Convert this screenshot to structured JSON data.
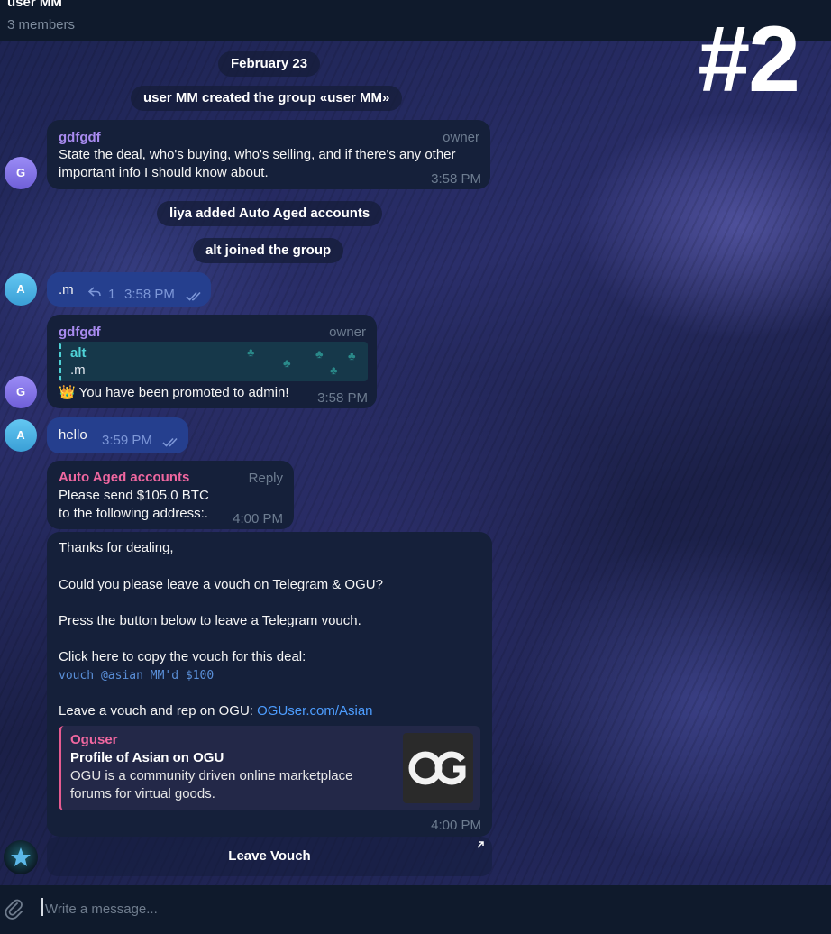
{
  "header": {
    "title": "user MM",
    "subtitle": "3 members"
  },
  "watermark": "#2",
  "service": {
    "date": "February 23",
    "created": "user MM created the group «user MM»",
    "added": "liya added Auto Aged accounts",
    "joined": "alt joined the group"
  },
  "messages": {
    "m1": {
      "avatar": "G",
      "sender": "gdfgdf",
      "role": "owner",
      "lines": [
        "State the deal, who's buying, who's selling, and if there's any other",
        "important info I should know about."
      ],
      "time": "3:58 PM"
    },
    "m2": {
      "avatar": "A",
      "text": ".m",
      "replies": "1",
      "time": "3:58 PM"
    },
    "m3": {
      "avatar": "G",
      "sender": "gdfgdf",
      "role": "owner",
      "reply_name": "alt",
      "reply_text": ".m",
      "emoji": "👑",
      "text": "You have been promoted to admin!",
      "time": "3:58 PM"
    },
    "m4": {
      "avatar": "A",
      "text": "hello",
      "time": "3:59 PM"
    },
    "m5": {
      "sender": "Auto Aged accounts",
      "role": "Reply",
      "lines": [
        "Please send $105.0 BTC",
        "to the following address:."
      ],
      "time": "4:00 PM"
    },
    "m6": {
      "p1": "Thanks for dealing,",
      "p2": "Could you please leave a vouch on Telegram & OGU?",
      "p3": "Press the button below to leave a Telegram vouch.",
      "p4": "Click here to copy the vouch for this deal:",
      "code": "vouch @asian MM'd $100",
      "p5_prefix": "Leave a vouch and rep on OGU: ",
      "p5_link": "OGUser.com/Asian",
      "preview": {
        "site": "Oguser",
        "title": "Profile of Asian on OGU",
        "desc": "OGU is a community driven online marketplace forums for virtual goods.",
        "thumb": "OG"
      },
      "time": "4:00 PM"
    }
  },
  "keyboard": {
    "button": "Leave Vouch"
  },
  "composer": {
    "placeholder": "Write a message..."
  },
  "colors": {
    "accent_link": "#4d9dff",
    "sender_purple": "#a98bf0",
    "sender_pink": "#f067a0",
    "outgoing": "#253f8e"
  }
}
